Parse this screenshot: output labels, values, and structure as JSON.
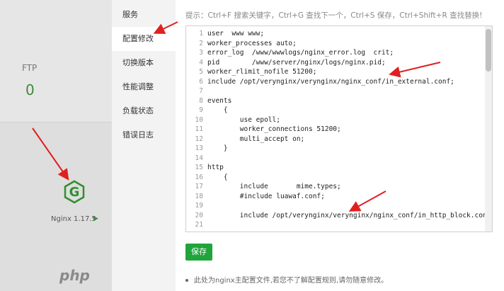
{
  "background": {
    "ftp_label": "FTP",
    "ftp_count": "0",
    "nginx_name": "Nginx 1.17.5",
    "nginx_play_icon": "▶",
    "php_label": "php"
  },
  "menu": [
    {
      "label": "服务",
      "active": false
    },
    {
      "label": "配置修改",
      "active": true
    },
    {
      "label": "切换版本",
      "active": false
    },
    {
      "label": "性能调整",
      "active": false
    },
    {
      "label": "负载状态",
      "active": false
    },
    {
      "label": "错误日志",
      "active": false
    }
  ],
  "hint": "提示：Ctrl+F 搜索关键字，Ctrl+G 查找下一个，Ctrl+S 保存，Ctrl+Shift+R 查找替换!",
  "editor_lines": [
    {
      "n": "1",
      "text": "user  www www;"
    },
    {
      "n": "2",
      "text": "worker_processes auto;"
    },
    {
      "n": "3",
      "text": "error_log  /www/wwwlogs/nginx_error.log  crit;"
    },
    {
      "n": "4",
      "text": "pid        /www/server/nginx/logs/nginx.pid;"
    },
    {
      "n": "5",
      "text": "worker_rlimit_nofile 51200;"
    },
    {
      "n": "6",
      "text": "include /opt/verynginx/verynginx/nginx_conf/in_external.conf;"
    },
    {
      "n": "7",
      "text": ""
    },
    {
      "n": "8",
      "text": "events"
    },
    {
      "n": "9",
      "text": "    {"
    },
    {
      "n": "10",
      "text": "        use epoll;"
    },
    {
      "n": "11",
      "text": "        worker_connections 51200;"
    },
    {
      "n": "12",
      "text": "        multi_accept on;"
    },
    {
      "n": "13",
      "text": "    }"
    },
    {
      "n": "14",
      "text": ""
    },
    {
      "n": "15",
      "text": "http"
    },
    {
      "n": "16",
      "text": "    {"
    },
    {
      "n": "17",
      "text": "        include       mime.types;"
    },
    {
      "n": "18",
      "text": "        #include luawaf.conf;"
    },
    {
      "n": "19",
      "text": ""
    },
    {
      "n": "20",
      "text": "        include /opt/verynginx/verynginx/nginx_conf/in_http_block.conf;"
    },
    {
      "n": "21",
      "text": ""
    }
  ],
  "save_label": "保存",
  "note": "此处为nginx主配置文件,若您不了解配置规则,请勿随意修改。",
  "colors": {
    "accent": "#20a53a",
    "arrow": "#e02020"
  }
}
